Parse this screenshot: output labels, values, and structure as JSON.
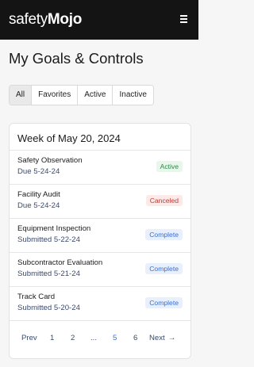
{
  "brand": {
    "light": "safety",
    "bold": "Mojo"
  },
  "page_title": "My Goals & Controls",
  "filters": [
    "All",
    "Favorites",
    "Active",
    "Inactive"
  ],
  "card_title": "Week of May 20, 2024",
  "goals": [
    {
      "name": "Safety Observation",
      "sub": "Due 5-24-24",
      "status": "Active"
    },
    {
      "name": "Facility Audit",
      "sub": "Due 5-24-24",
      "status": "Canceled"
    },
    {
      "name": "Equipment Inspection",
      "sub": "Submitted 5-22-24",
      "status": "Complete"
    },
    {
      "name": "Subcontractor Evaluation",
      "sub": "Submitted 5-21-24",
      "status": "Complete"
    },
    {
      "name": "Track Card",
      "sub": "Submitted 5-20-24",
      "status": "Complete"
    }
  ],
  "pagination": {
    "prev": "Prev",
    "pages": [
      "1",
      "2",
      "...",
      "5",
      "6"
    ],
    "current": "5",
    "next": "Next",
    "next_arrow": "→"
  },
  "colors": {
    "topbar": "#141414",
    "active": "#2a8a45",
    "canceled": "#c53a33",
    "complete": "#3a6fd0",
    "current_page": "#3a72d8"
  },
  "icons": {
    "menu": "hamburger-menu-icon",
    "next": "arrow-right-icon"
  }
}
